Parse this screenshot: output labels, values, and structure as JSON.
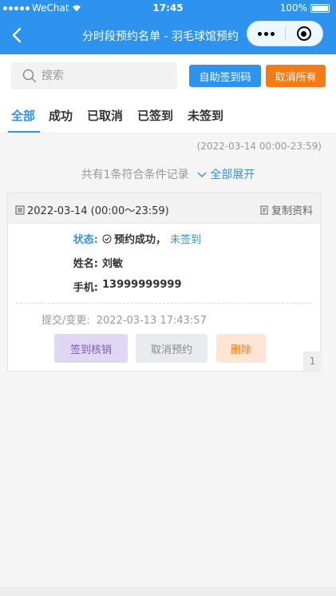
{
  "status_bar": {
    "carrier": "WeChat",
    "time": "17:45",
    "battery": "100%"
  },
  "navbar": {
    "title": "分时段预约名单 - 羽毛球馆预约"
  },
  "search": {
    "placeholder": "搜索",
    "icon": "search-icon"
  },
  "toolbar": {
    "sign_code_label": "自助签到码",
    "cancel_all_label": "取消所有"
  },
  "tabs": [
    {
      "label": "全部"
    },
    {
      "label": "成功"
    },
    {
      "label": "已取消"
    },
    {
      "label": "已签到"
    },
    {
      "label": "未签到"
    }
  ],
  "range_text": "(2022-03-14 00:00-23:59)",
  "summary": {
    "text": "共有1条符合条件记录",
    "expand_label": "全部展开"
  },
  "record": {
    "date": "2022-03-14 (00:00～23:59)",
    "copy_label": "复制资料",
    "status_label": "状态:",
    "status_value": "预约成功，",
    "status_sub": "未签到",
    "name_label": "姓名:",
    "name_value": "刘敏",
    "phone_label": "手机:",
    "phone_value": "13999999999",
    "submit_label": "提交/变更:",
    "submit_value": "2022-03-13 17:43:57",
    "actions": {
      "checkin": "签到核销",
      "cancel": "取消预约",
      "delete": "删除"
    },
    "page_badge": "1"
  },
  "colors": {
    "primary": "#2e93ee",
    "orange": "#f57c14",
    "purple_text": "#7d5bc4"
  }
}
